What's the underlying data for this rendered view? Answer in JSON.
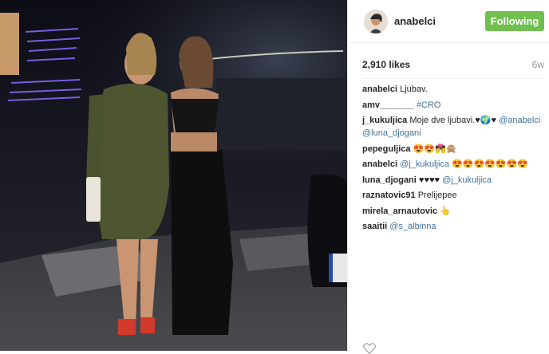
{
  "post": {
    "username": "anabelci",
    "follow_label": "Following",
    "likes": "2,910 likes",
    "time_ago": "6w",
    "comments": [
      {
        "user": "anabelci",
        "parts": [
          {
            "type": "text",
            "text": "Ljubav."
          }
        ]
      },
      {
        "user": "amv_______",
        "parts": [
          {
            "type": "link",
            "text": "#CRO"
          }
        ]
      },
      {
        "user": "j_kukuljica",
        "parts": [
          {
            "type": "text",
            "text": "Moje dve ljubavi.♥🌍♥"
          },
          {
            "type": "link",
            "text": "@anabelci"
          },
          {
            "type": "link",
            "text": "@luna_djogani"
          }
        ]
      },
      {
        "user": "pepeguljica",
        "parts": [
          {
            "type": "text",
            "text": "😍😍💏🙊"
          }
        ]
      },
      {
        "user": "anabelci",
        "parts": [
          {
            "type": "link",
            "text": "@j_kukuljica"
          },
          {
            "type": "text",
            "text": "😍😍😍😍😍😍😍"
          }
        ]
      },
      {
        "user": "luna_djogani",
        "parts": [
          {
            "type": "text",
            "text": "♥♥♥♥"
          },
          {
            "type": "link",
            "text": "@j_kukuljica"
          }
        ]
      },
      {
        "user": "raznatovic91",
        "parts": [
          {
            "type": "text",
            "text": "Prelijepee"
          }
        ]
      },
      {
        "user": "mirela_arnautovic",
        "parts": [
          {
            "type": "text",
            "text": "👆"
          }
        ]
      },
      {
        "user": "saaitii",
        "parts": [
          {
            "type": "link",
            "text": "@s_albinna"
          }
        ]
      }
    ]
  },
  "colors": {
    "follow_green": "#70c050",
    "link_blue": "#3f729b",
    "text_dark": "#262626",
    "muted": "#999999"
  },
  "icons": {
    "avatar": "profile-avatar",
    "heart": "heart-icon"
  }
}
